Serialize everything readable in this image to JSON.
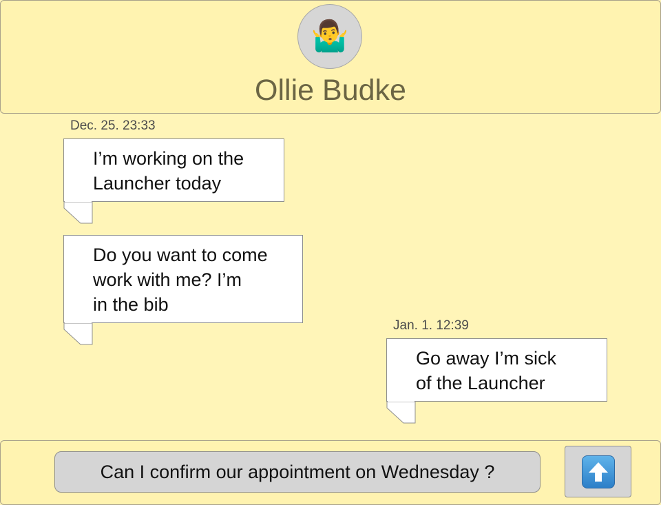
{
  "header": {
    "avatar_emoji": "🤷‍♂️",
    "avatar_icon": "man-shrugging-icon",
    "contact_name": "Ollie Budke"
  },
  "messages": [
    {
      "timestamp": "Dec. 25. 23:33",
      "text": "I’m working on the\nLauncher today"
    },
    {
      "timestamp": "",
      "text": "Do you want to come\nwork with me? I’m\nin the bib"
    },
    {
      "timestamp": "Jan. 1. 12:39",
      "text": "Go away I’m sick\nof the Launcher"
    }
  ],
  "compose": {
    "value": "Can I confirm our appointment on Wednesday ?"
  },
  "send_button": {
    "icon": "up-arrow-icon",
    "icon_color": "#3a8fd6"
  },
  "colors": {
    "background": "#fff5b8",
    "header_text": "#6b6544",
    "bubble": "#ffffff",
    "input": "#d5d5d5"
  }
}
